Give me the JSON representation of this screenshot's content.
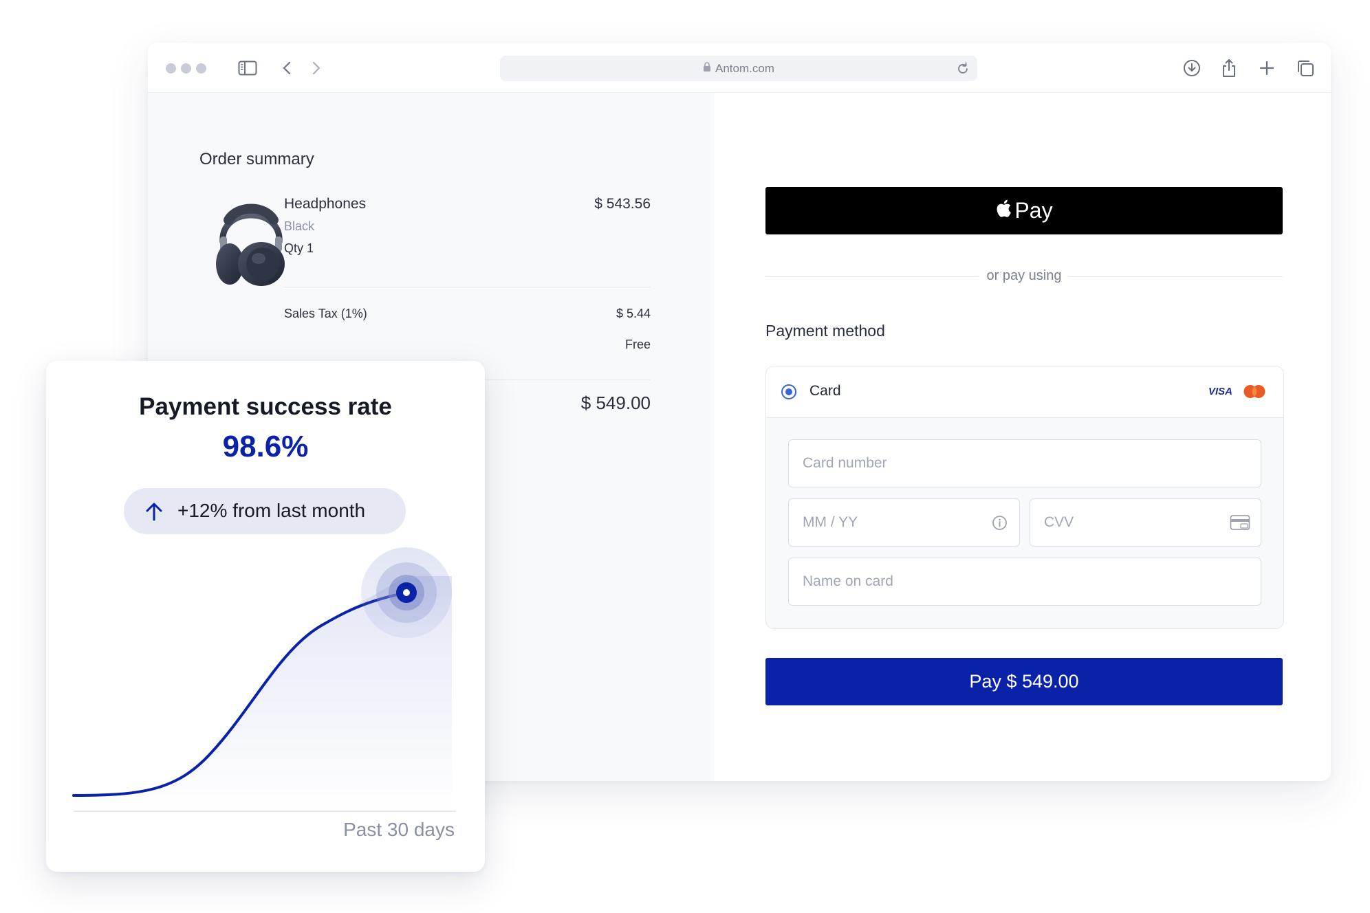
{
  "browser": {
    "url": "Antom.com",
    "icons": [
      "sidebar-icon",
      "back-icon",
      "forward-icon",
      "lock-icon",
      "reload-icon",
      "download-icon",
      "share-icon",
      "plus-icon",
      "tabs-icon"
    ]
  },
  "order": {
    "title": "Order summary",
    "item": {
      "name": "Headphones",
      "variant": "Black",
      "qty": "Qty 1",
      "price": "$ 543.56"
    },
    "tax_label": "Sales Tax (1%)",
    "tax_value": "$ 5.44",
    "shipping_value": "Free",
    "total_value": "$ 549.00"
  },
  "payment": {
    "applepay_label": "Pay",
    "divider_text": "or pay using",
    "method_title": "Payment method",
    "card_label": "Card",
    "visa_label": "VISA",
    "card_number_placeholder": "Card number",
    "expiry_placeholder": "MM / YY",
    "cvv_placeholder": "CVV",
    "name_placeholder": "Name on card",
    "pay_button": "Pay $ 549.00"
  },
  "stats": {
    "title": "Payment success rate",
    "value": "98.6%",
    "change": "+12% from last month",
    "period": "Past 30 days"
  },
  "colors": {
    "brand": "#0a22a8",
    "mastercard": "#ea5a26",
    "radio": "#3a63d8"
  }
}
